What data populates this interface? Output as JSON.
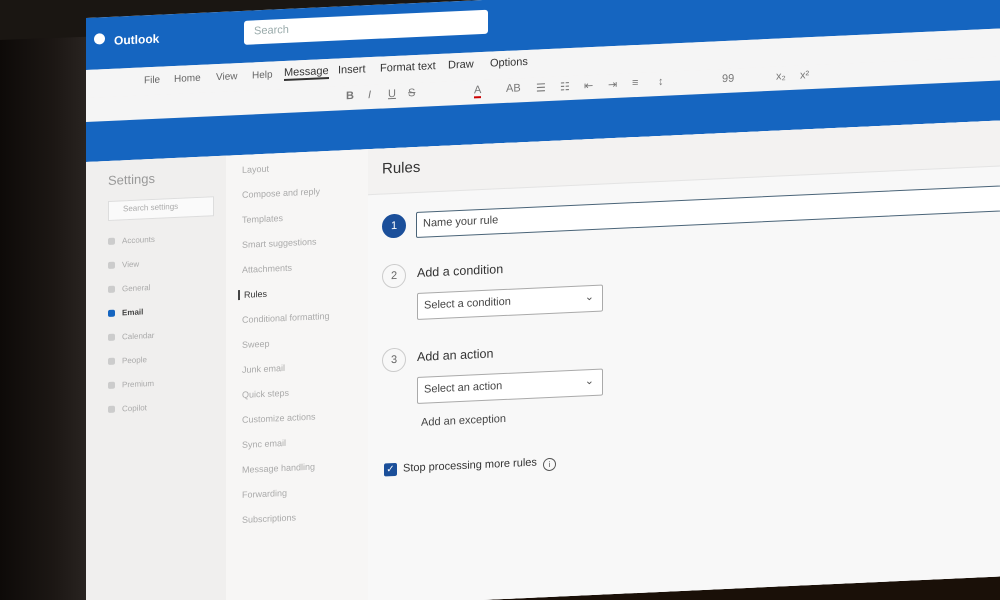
{
  "app": {
    "title": "Outlook",
    "search_placeholder": "Search"
  },
  "ribbon": {
    "tabs": [
      "File",
      "Home",
      "View",
      "Help",
      "Message",
      "Insert",
      "Format text",
      "Draw",
      "Options"
    ],
    "active_tab": "Message",
    "tools": [
      "B",
      "I",
      "U",
      "S",
      "A",
      "AB",
      "99",
      "x₂",
      "x²"
    ]
  },
  "settings": {
    "title": "Settings",
    "search_placeholder": "Search settings",
    "nav": [
      "Accounts",
      "View",
      "General",
      "Email",
      "Calendar",
      "People",
      "Premium",
      "Copilot"
    ],
    "active_nav": "Email"
  },
  "email_settings": {
    "items": [
      "Layout",
      "Compose and reply",
      "Templates",
      "Smart suggestions",
      "Attachments",
      "Rules",
      "Conditional formatting",
      "Sweep",
      "Junk email",
      "Quick steps",
      "Customize actions",
      "Sync email",
      "Message handling",
      "Forwarding",
      "Subscriptions"
    ],
    "active_item": "Rules"
  },
  "rules": {
    "title": "Rules",
    "step1_number": "1",
    "rule_name_placeholder": "Name your rule",
    "step2_number": "2",
    "step2_label": "Add a condition",
    "condition_placeholder": "Select a condition",
    "step3_number": "3",
    "step3_label": "Add an action",
    "action_placeholder": "Select an action",
    "add_exception": "Add an exception",
    "stop_processing_label": "Stop processing more rules",
    "stop_processing_checked": true
  },
  "colors": {
    "brand_blue": "#1565c0",
    "step_active": "#1b4f9a"
  }
}
